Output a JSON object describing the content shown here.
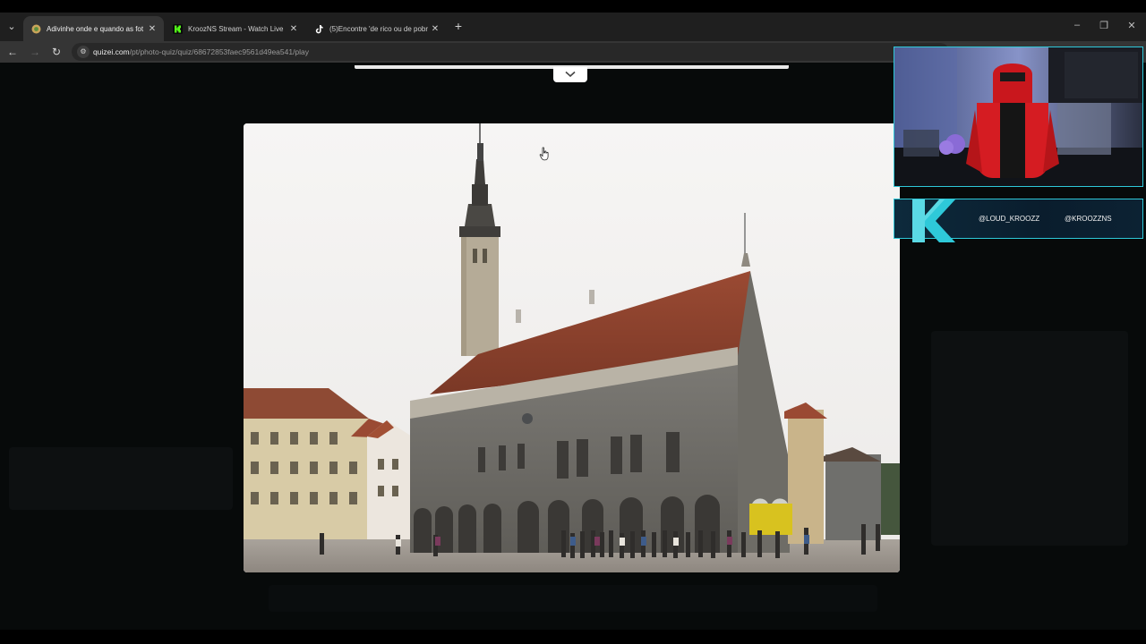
{
  "browser": {
    "tabs": [
      {
        "title": "Adivinhe onde e quando as fot",
        "active": true,
        "favicon": "quizei-favicon"
      },
      {
        "title": "KroozNS Stream - Watch Live",
        "active": false,
        "favicon": "kick-favicon"
      },
      {
        "title": "(5)Encontre 'de rico ou de pobr",
        "active": false,
        "favicon": "tiktok-favicon"
      }
    ],
    "url_host": "quizei.com",
    "url_path": "/pt/photo-quiz/quiz/68672853faec9561d49ea541/play"
  },
  "quiz": {
    "photo_subject": "medieval-town-hall-photo",
    "collapse_icon": "chevron-down-icon"
  },
  "stream_overlay": {
    "social_handles": [
      "@LOUD_KROOZZ",
      "@KROOZZNS"
    ],
    "logo_icon": "k-logo-icon"
  },
  "colors": {
    "overlay_accent": "#2ec9d9",
    "page_background": "#070a0a",
    "tab_active": "#353535",
    "kick_green": "#53fc18"
  }
}
